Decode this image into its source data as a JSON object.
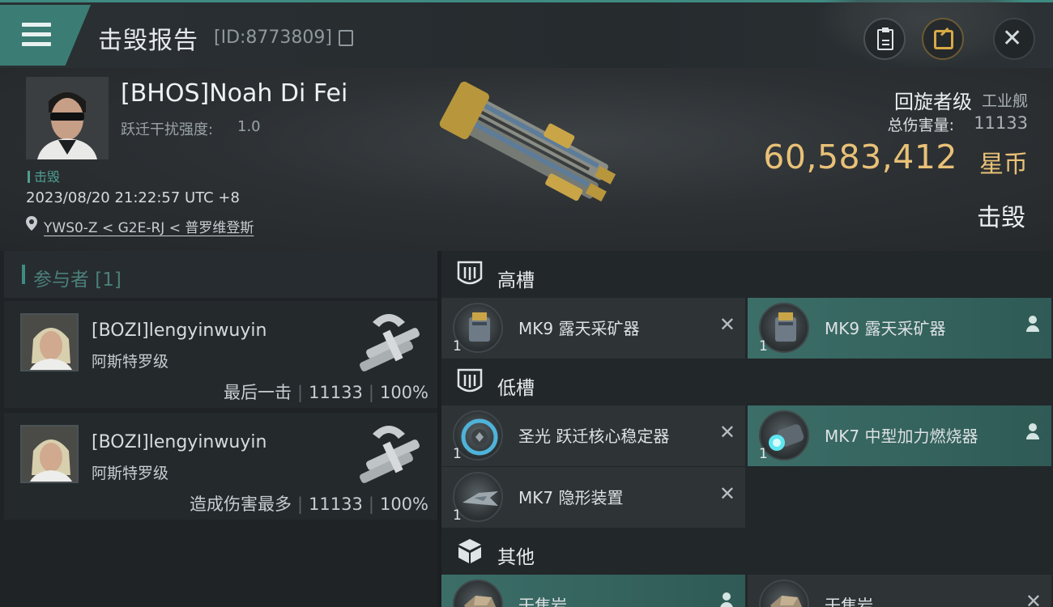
{
  "header": {
    "title": "击毁报告",
    "report_id": "[ID:8773809]"
  },
  "victim": {
    "name": "[BHOS]Noah Di Fei",
    "warp_label": "跃迁干扰强度:",
    "warp_value": "1.0",
    "kill_tag": "击毁",
    "time": "2023/08/20 21:22:57 UTC +8",
    "location": "YWS0-Z < G2E-RJ < 普罗维登斯",
    "ship_name": "回旋者级",
    "ship_class": "工业舰",
    "damage_label": "总伤害量:",
    "damage_value": "11133",
    "isk_value": "60,583,412",
    "isk_unit": "星币",
    "status": "击毁"
  },
  "participants": {
    "header": "参与者 [1]",
    "items": [
      {
        "name": "[BOZI]lengyinwuyin",
        "ship": "阿斯特罗级",
        "tag": "最后一击",
        "damage": "11133",
        "percent": "100%"
      },
      {
        "name": "[BOZI]lengyinwuyin",
        "ship": "阿斯特罗级",
        "tag": "造成伤害最多",
        "damage": "11133",
        "percent": "100%"
      }
    ]
  },
  "fitting": {
    "high_label": "高槽",
    "low_label": "低槽",
    "other_label": "其他",
    "high": [
      {
        "name": "MK9 露天采矿器",
        "qty": "1",
        "state": "destroyed"
      },
      {
        "name": "MK9 露天采矿器",
        "qty": "1",
        "state": "dropped"
      }
    ],
    "low": [
      {
        "name": "圣光 跃迁核心稳定器",
        "qty": "1",
        "state": "destroyed"
      },
      {
        "name": "MK7 中型加力燃烧器",
        "qty": "1",
        "state": "dropped"
      },
      {
        "name": "MK7 隐形装置",
        "qty": "1",
        "state": "destroyed"
      }
    ],
    "other": [
      {
        "name": "干焦岩",
        "qty": "",
        "state": "dropped"
      },
      {
        "name": "干焦岩",
        "qty": "",
        "state": "destroyed"
      }
    ]
  },
  "icons": {
    "menu": "hamburger-icon",
    "report": "clipboard-icon",
    "share": "share-icon",
    "close": "close-icon",
    "location": "map-pin-icon",
    "destroyed": "x-icon",
    "dropped": "person-icon"
  },
  "colors": {
    "accent": "#3f8b82",
    "isk": "#e9c177",
    "dropped_bg": "#3c6e68",
    "destroyed_bg": "#2e3336"
  }
}
